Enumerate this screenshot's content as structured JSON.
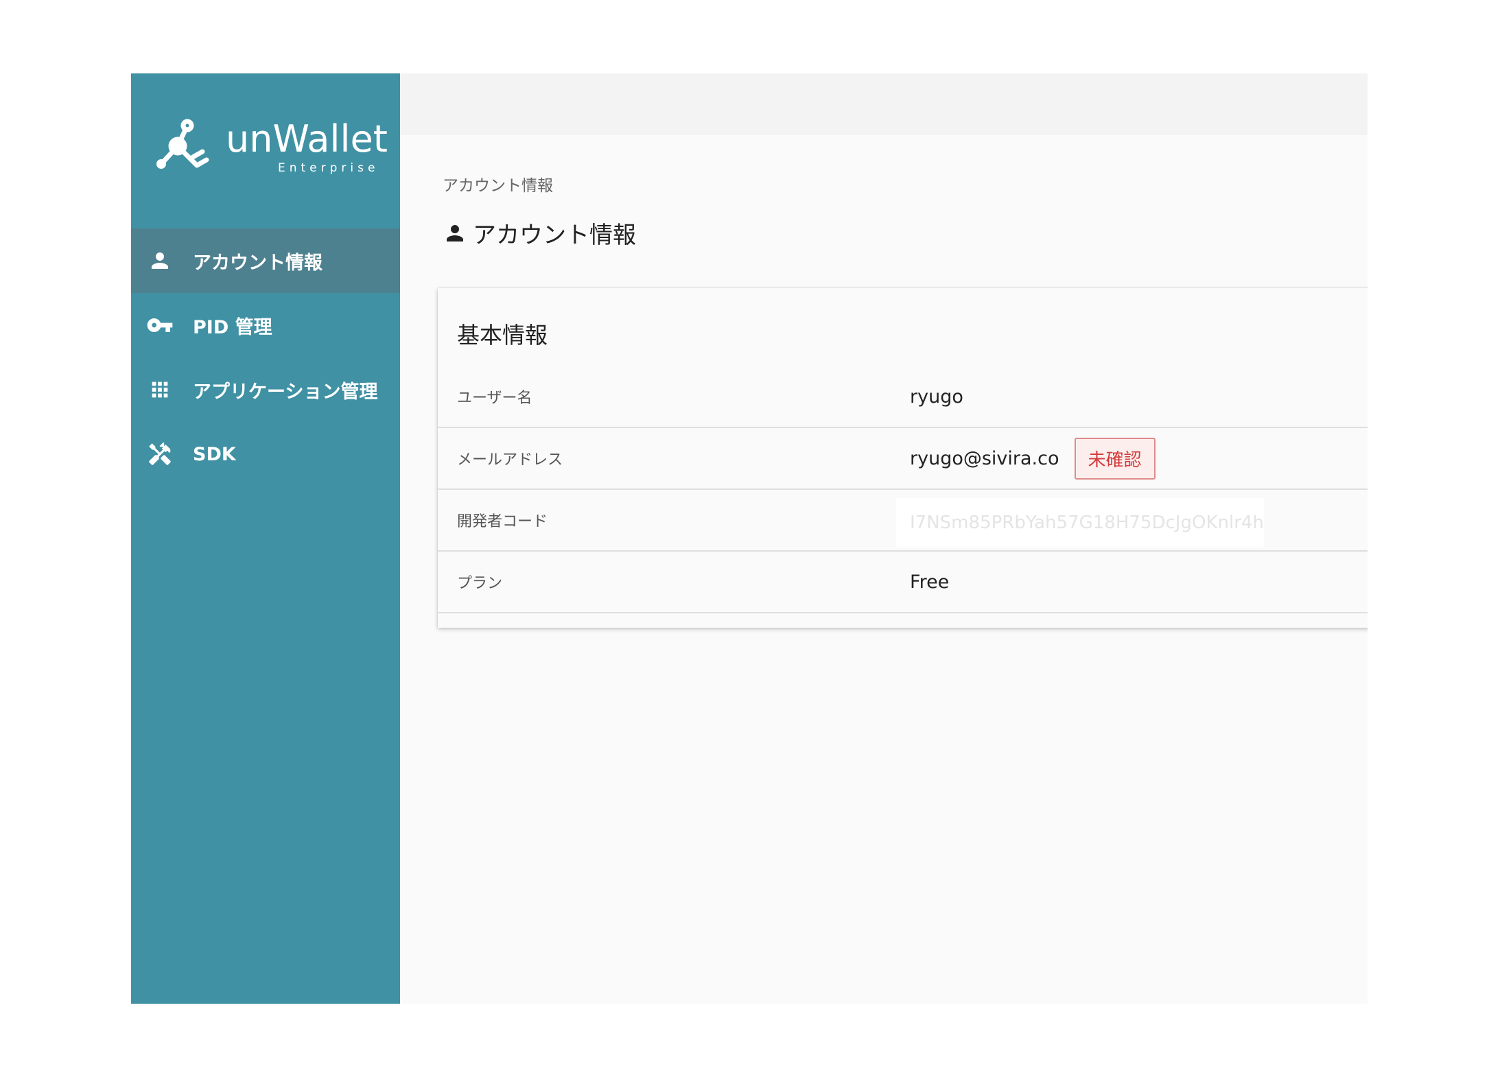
{
  "brand": {
    "name": "unWallet",
    "subtitle": "Enterprise"
  },
  "sidebar": {
    "items": [
      {
        "label": "アカウント情報",
        "icon": "person-icon",
        "active": true
      },
      {
        "label": "PID 管理",
        "icon": "key-icon",
        "active": false
      },
      {
        "label": "アプリケーション管理",
        "icon": "apps-grid-icon",
        "active": false
      },
      {
        "label": "SDK",
        "icon": "tools-icon",
        "active": false
      }
    ]
  },
  "main": {
    "breadcrumb": "アカウント情報",
    "title": "アカウント情報",
    "title_icon": "person-icon",
    "card": {
      "title": "基本情報",
      "rows": [
        {
          "label": "ユーザー名",
          "value": "ryugo"
        },
        {
          "label": "メールアドレス",
          "value": "ryugo@sivira.co",
          "badge": "未確認"
        },
        {
          "label": "開発者コード",
          "value": "I7NSm85PRbYah57G18H75DcJgOKnlr4h"
        },
        {
          "label": "プラン",
          "value": "Free"
        }
      ]
    }
  },
  "colors": {
    "sidebar_bg": "#4091a4",
    "sidebar_active": "#4e8190",
    "badge_text": "#d23c3c",
    "badge_bg": "#fdeeee"
  }
}
